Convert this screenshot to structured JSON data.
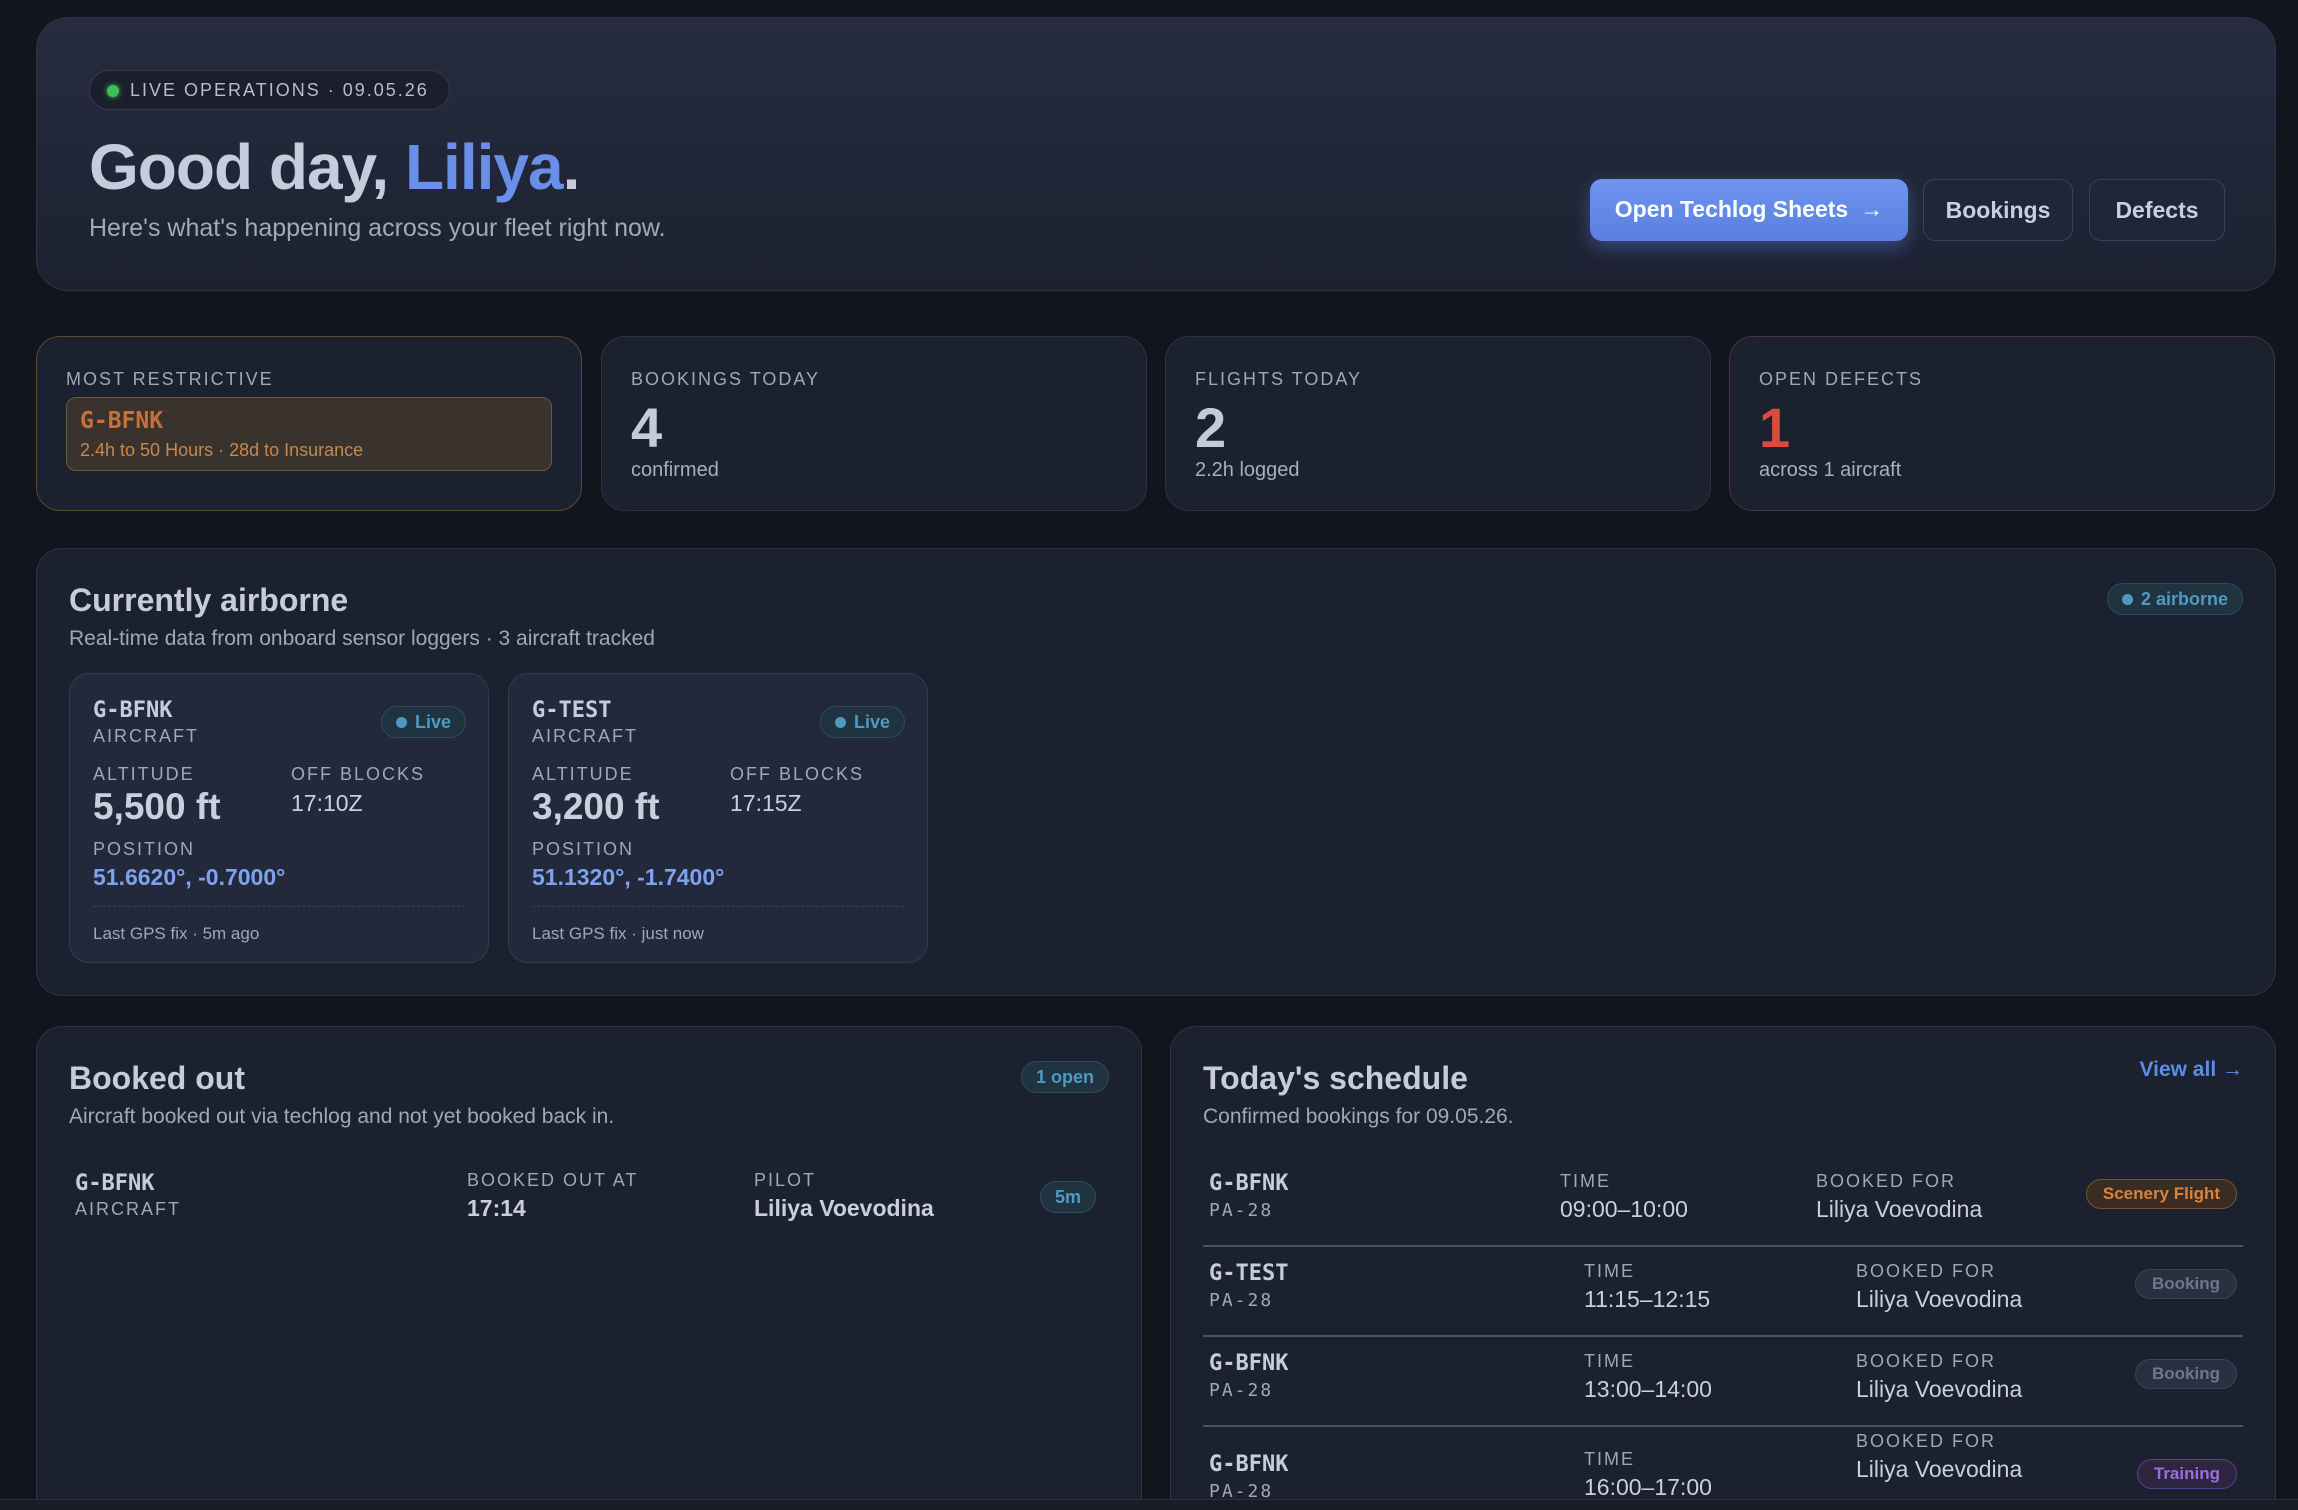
{
  "hero": {
    "live_label": "LIVE OPERATIONS · 09.05.26",
    "greeting_prefix": "Good day, ",
    "user_name": "Liliya",
    "greeting_suffix": ".",
    "subtitle": "Here's what's happening across your fleet right now.",
    "primary_button": "Open Techlog Sheets",
    "bookings_button": "Bookings",
    "defects_button": "Defects"
  },
  "stats": {
    "restrictive": {
      "label": "MOST RESTRICTIVE",
      "registration": "G-BFNK",
      "detail": "2.4h to 50 Hours · 28d to Insurance"
    },
    "bookings": {
      "label": "BOOKINGS TODAY",
      "value": "4",
      "sub": "confirmed"
    },
    "flights": {
      "label": "FLIGHTS TODAY",
      "value": "2",
      "sub": "2.2h logged"
    },
    "defects": {
      "label": "OPEN DEFECTS",
      "value": "1",
      "sub": "across 1 aircraft"
    }
  },
  "airborne": {
    "title": "Currently airborne",
    "subtitle": "Real-time data from onboard sensor loggers · 3 aircraft tracked",
    "count_badge": "2 airborne",
    "labels": {
      "type": "AIRCRAFT",
      "live": "Live",
      "altitude": "ALTITUDE",
      "off_blocks": "OFF BLOCKS",
      "position": "POSITION"
    },
    "aircraft": [
      {
        "registration": "G-BFNK",
        "altitude": "5,500 ft",
        "off_blocks": "17:10Z",
        "position": "51.6620°, -0.7000°",
        "gps": "Last GPS fix · 5m ago"
      },
      {
        "registration": "G-TEST",
        "altitude": "3,200 ft",
        "off_blocks": "17:15Z",
        "position": "51.1320°, -1.7400°",
        "gps": "Last GPS fix · just now"
      }
    ]
  },
  "booked_out": {
    "title": "Booked out",
    "subtitle": "Aircraft booked out via techlog and not yet booked back in.",
    "count_badge": "1 open",
    "labels": {
      "type": "AIRCRAFT",
      "booked_out_at": "BOOKED OUT AT",
      "pilot": "PILOT"
    },
    "rows": [
      {
        "registration": "G-BFNK",
        "time": "17:14",
        "pilot": "Liliya Voevodina",
        "duration": "5m"
      }
    ]
  },
  "schedule": {
    "title": "Today's schedule",
    "subtitle": "Confirmed bookings for 09.05.26.",
    "view_all": "View all →",
    "labels": {
      "time": "TIME",
      "booked_for": "BOOKED FOR"
    },
    "rows": [
      {
        "registration": "G-BFNK",
        "type": "PA-28",
        "time": "09:00–10:00",
        "booked_for": "Liliya Voevodina",
        "tag": "Scenery Flight",
        "tag_color": "#d8843e"
      },
      {
        "registration": "G-TEST",
        "type": "PA-28",
        "time": "11:15–12:15",
        "booked_for": "Liliya Voevodina",
        "tag": "Booking",
        "tag_color": "#6e7789"
      },
      {
        "registration": "G-BFNK",
        "type": "PA-28",
        "time": "13:00–14:00",
        "booked_for": "Liliya Voevodina",
        "tag": "Booking",
        "tag_color": "#6e7789"
      },
      {
        "registration": "G-BFNK",
        "type": "PA-28",
        "time": "16:00–17:00",
        "booked_for": "Liliya Voevodina",
        "tag": "Training",
        "tag_color": "#9a6ee0"
      }
    ]
  },
  "colors": {
    "accent": "#6a8fe6",
    "live_green": "#3fbf5a",
    "defect_red": "#d94b3f",
    "warning_orange": "#c8703a"
  },
  "icons": {
    "primary_button_icon": "arrow-right-icon",
    "live_icon": "status-dot-icon"
  }
}
